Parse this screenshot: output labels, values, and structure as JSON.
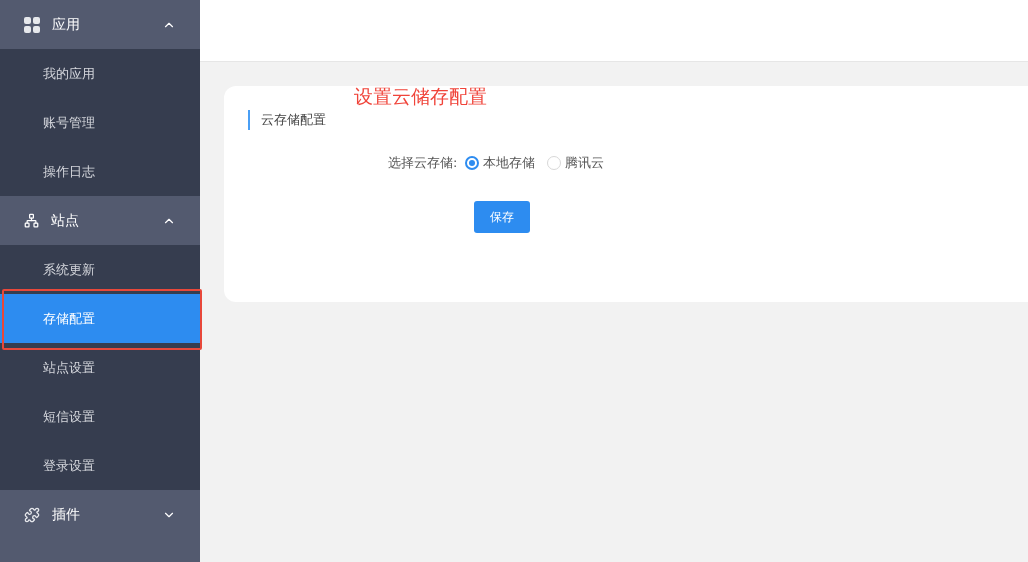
{
  "sidebar": {
    "groups": [
      {
        "label": "应用",
        "expanded": true,
        "items": [
          {
            "label": "我的应用",
            "selected": false,
            "highlighted": false
          },
          {
            "label": "账号管理",
            "selected": false,
            "highlighted": false
          },
          {
            "label": "操作日志",
            "selected": false,
            "highlighted": false
          }
        ]
      },
      {
        "label": "站点",
        "expanded": true,
        "items": [
          {
            "label": "系统更新",
            "selected": false,
            "highlighted": false
          },
          {
            "label": "存储配置",
            "selected": true,
            "highlighted": true
          },
          {
            "label": "站点设置",
            "selected": false,
            "highlighted": false
          },
          {
            "label": "短信设置",
            "selected": false,
            "highlighted": false
          },
          {
            "label": "登录设置",
            "selected": false,
            "highlighted": false
          }
        ]
      },
      {
        "label": "插件",
        "expanded": false
      }
    ]
  },
  "annotation": {
    "text": "设置云储存配置"
  },
  "card": {
    "title": "云存储配置",
    "field_label": "选择云存储:",
    "options": [
      {
        "label": "本地存储",
        "selected": true
      },
      {
        "label": "腾讯云",
        "selected": false
      }
    ],
    "save_button": "保存"
  }
}
